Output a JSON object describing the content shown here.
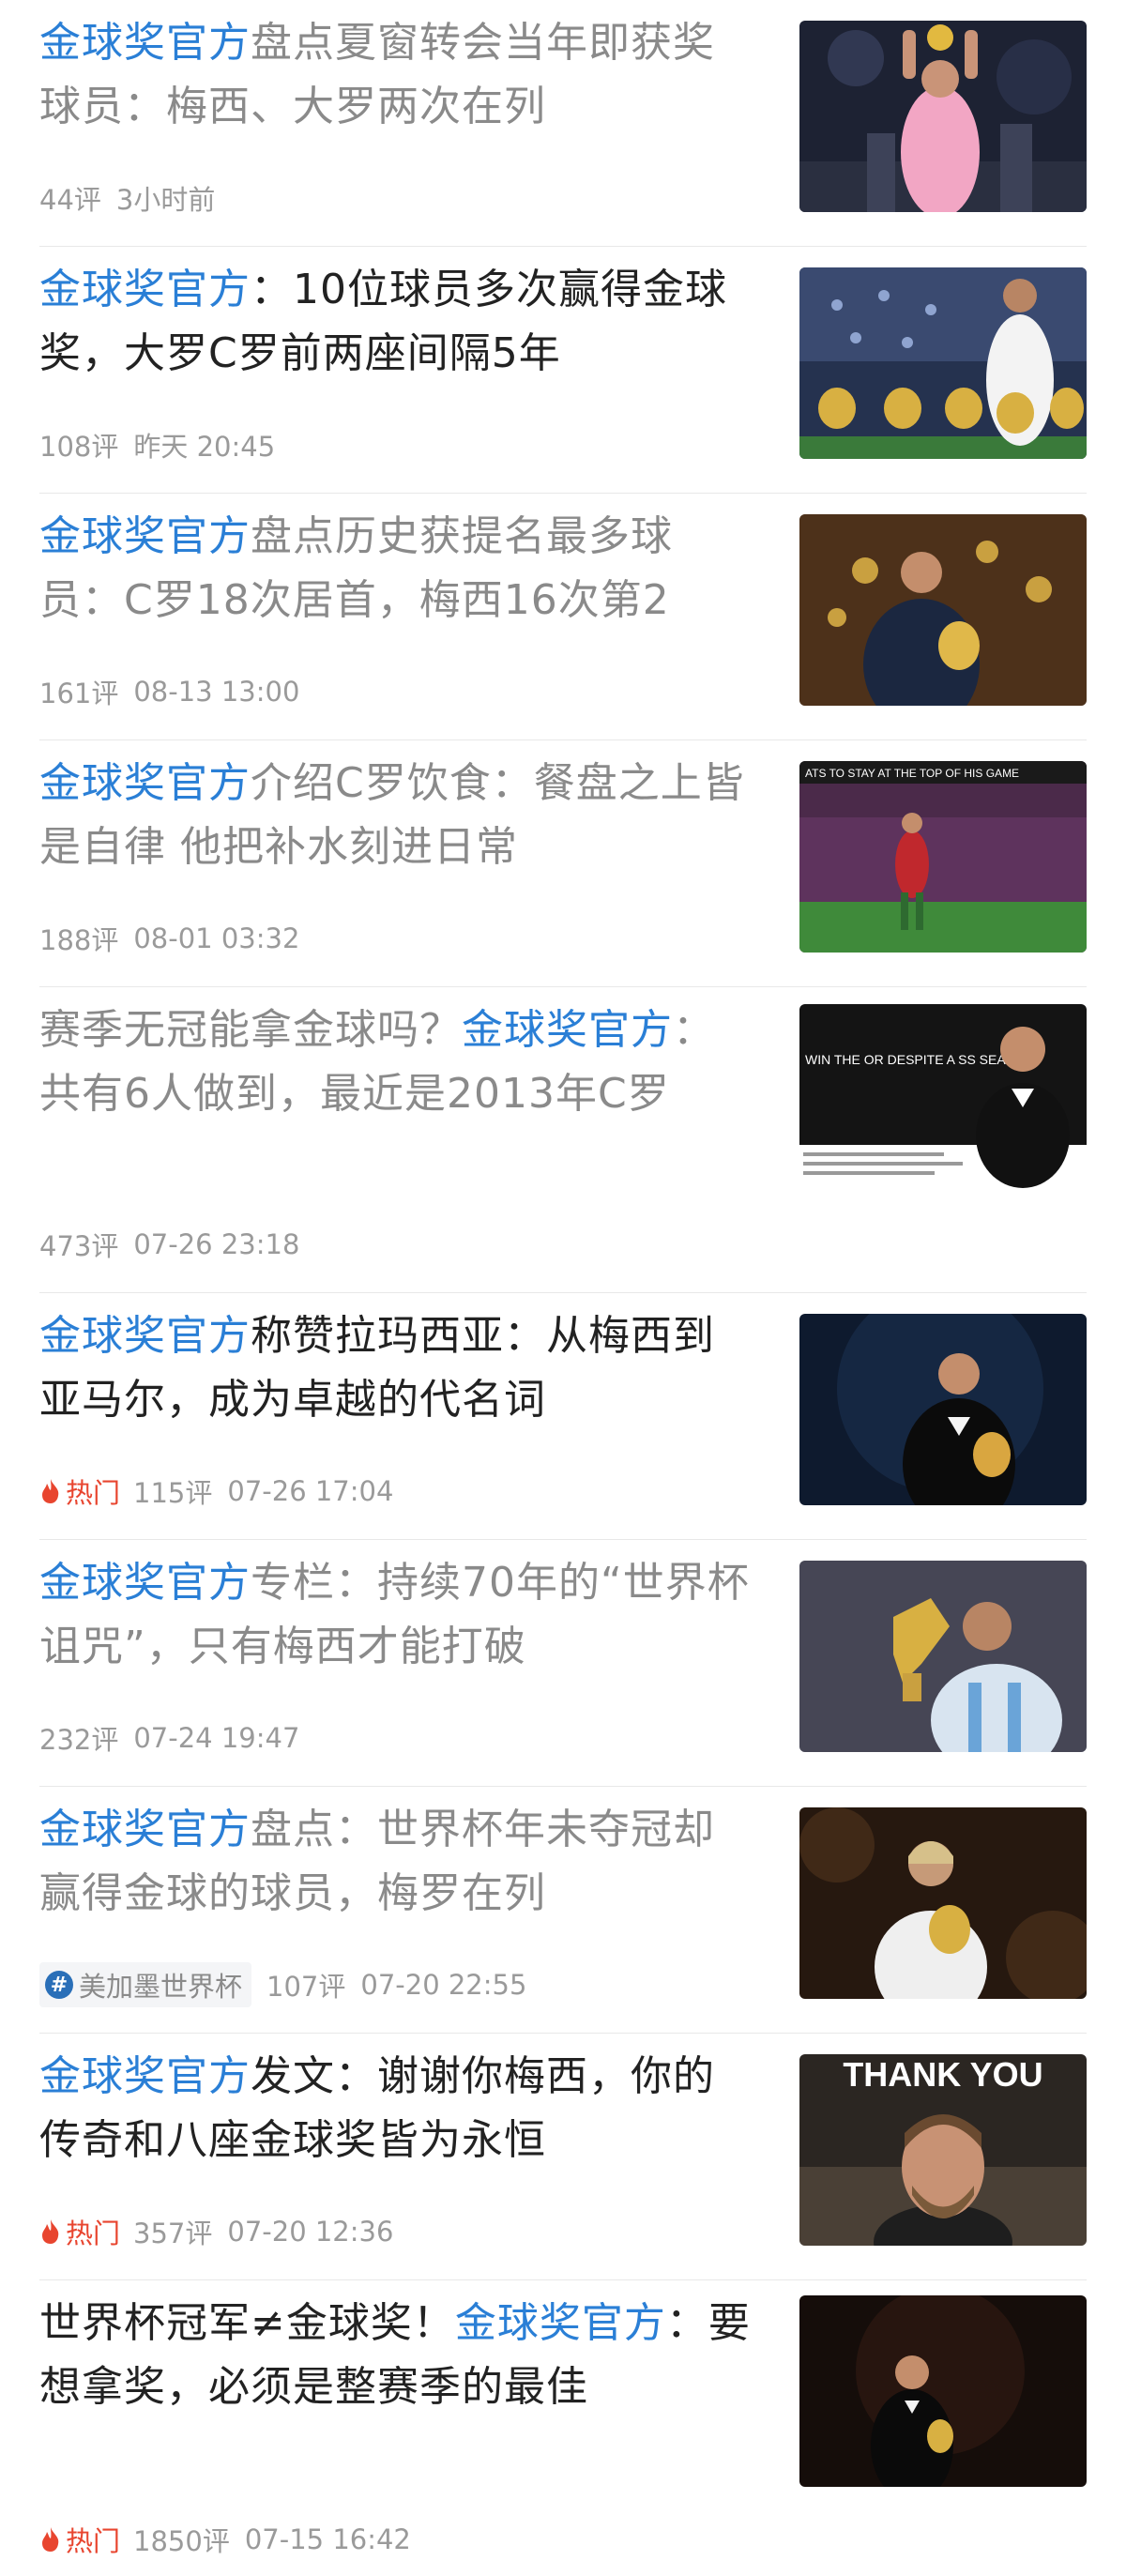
{
  "feed": {
    "items": [
      {
        "kw": "金球奖官方",
        "rest": "盘点夏窗转会当年即获奖球员：梅西、大罗两次在列",
        "comments": "44评",
        "time": "3小时前"
      },
      {
        "kw": "金球奖官方",
        "rest": "：10位球员多次赢得金球奖，大罗C罗前两座间隔5年",
        "comments": "108评",
        "time": "昨天 20:45"
      },
      {
        "kw": "金球奖官方",
        "rest": "盘点历史获提名最多球员：C罗18次居首，梅西16次第2",
        "comments": "161评",
        "time": "08-13 13:00"
      },
      {
        "kw": "金球奖官方",
        "rest": "介绍C罗饮食：餐盘之上皆是自律 他把补水刻进日常",
        "comments": "188评",
        "time": "08-01 03:32"
      },
      {
        "pre": "赛季无冠能拿金球吗？",
        "kw": "金球奖官方",
        "rest": "：共有6人做到，最近是2013年C罗",
        "comments": "473评",
        "time": "07-26 23:18"
      },
      {
        "kw": "金球奖官方",
        "rest": "称赞拉玛西亚：从梅西到亚马尔，成为卓越的代名词",
        "hot": "热门",
        "comments": "115评",
        "time": "07-26 17:04"
      },
      {
        "kw": "金球奖官方",
        "rest": "专栏：持续70年的“世界杯诅咒”，只有梅西才能打破",
        "comments": "232评",
        "time": "07-24 19:47"
      },
      {
        "kw": "金球奖官方",
        "rest": "盘点：世界杯年未夺冠却赢得金球的球员，梅罗在列",
        "tag": "美加墨世界杯",
        "comments": "107评",
        "time": "07-20 22:55"
      },
      {
        "kw": "金球奖官方",
        "rest": "发文：谢谢你梅西，你的传奇和八座金球奖皆为永恒",
        "hot": "热门",
        "comments": "357评",
        "time": "07-20 12:36"
      },
      {
        "pre": "世界杯冠军≠金球奖！",
        "kw": "金球奖官方",
        "rest": "：要想拿奖，必须是整赛季的最佳",
        "hot": "热门",
        "comments": "1850评",
        "time": "07-15 16:42"
      }
    ],
    "thumbs": {
      "t4_banner": "ATS TO STAY AT THE TOP OF HIS GAME",
      "t5_text": "WIN THE OR DESPITE A SS SEASON?",
      "t9_text": "THANK YOU"
    }
  }
}
